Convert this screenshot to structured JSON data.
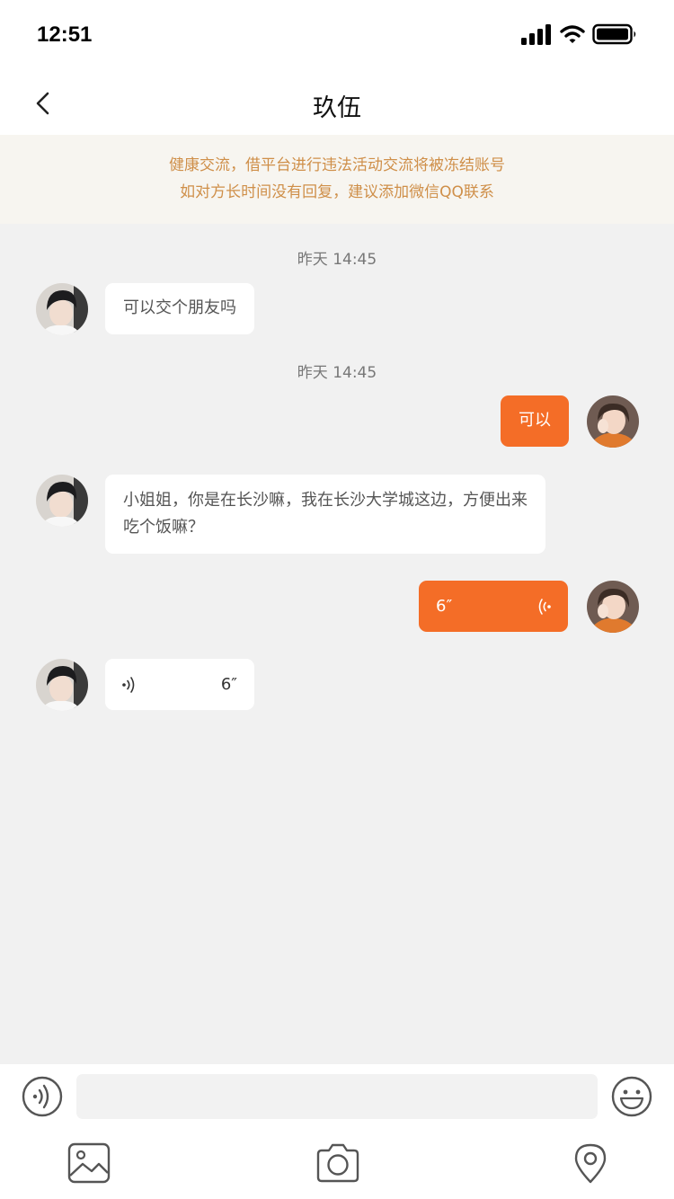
{
  "status_bar": {
    "time": "12:51"
  },
  "nav": {
    "title": "玖伍"
  },
  "notice": {
    "line1": "健康交流，借平台进行违法活动交流将被冻结账号",
    "line2": "如对方长时间没有回复，建议添加微信QQ联系"
  },
  "messages": [
    {
      "timestamp": "昨天 14:45",
      "direction": "in",
      "type": "text",
      "text": "可以交个朋友吗"
    },
    {
      "timestamp": "昨天 14:45",
      "direction": "out",
      "type": "text",
      "text": "可以"
    },
    {
      "direction": "in",
      "type": "text",
      "text_line1": "小姐姐，你是在长沙嘛，我在长沙大学城这边，方便出来",
      "text_line2": "吃个饭嘛？"
    },
    {
      "direction": "out",
      "type": "voice",
      "duration": "6″"
    },
    {
      "direction": "in",
      "type": "voice",
      "duration": "6″"
    }
  ],
  "input": {
    "placeholder": ""
  },
  "colors": {
    "accent": "#f46d27",
    "notice_text": "#cf8f49",
    "background": "#f1f1f1"
  },
  "icons": {
    "voice_toggle": "voice-wave-icon",
    "emoji": "smile-icon",
    "image": "image-icon",
    "camera": "camera-icon",
    "location": "location-pin-icon"
  }
}
